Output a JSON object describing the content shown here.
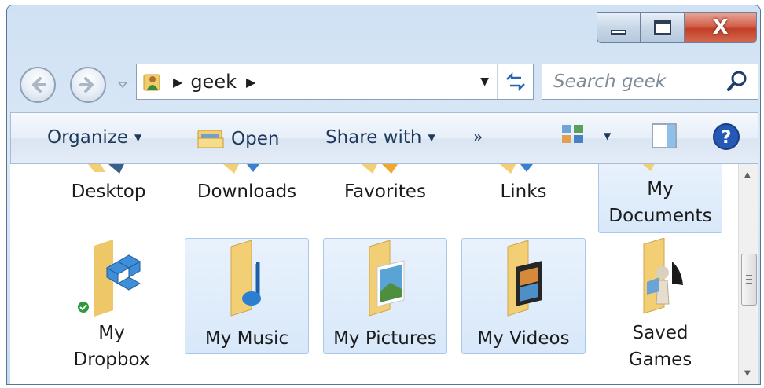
{
  "window": {
    "controls": {
      "minimize": "minimize",
      "maximize": "maximize",
      "close": "X"
    }
  },
  "navigation": {
    "breadcrumb": [
      "geek"
    ],
    "search_placeholder": "Search geek"
  },
  "toolbar": {
    "organize_label": "Organize",
    "open_label": "Open",
    "share_label": "Share with",
    "more_label": "»"
  },
  "items_top_row": [
    {
      "label": "Desktop",
      "selected": false
    },
    {
      "label": "Downloads",
      "selected": false
    },
    {
      "label": "Favorites",
      "selected": false
    },
    {
      "label": "Links",
      "selected": false
    },
    {
      "label": "My Documents",
      "selected": true
    }
  ],
  "items_second_row": [
    {
      "label_line1": "My",
      "label_line2": "Dropbox",
      "selected": false,
      "badge": "sync-ok"
    },
    {
      "label": "My Music",
      "selected": true
    },
    {
      "label": "My Pictures",
      "selected": true
    },
    {
      "label": "My Videos",
      "selected": true
    },
    {
      "label_line1": "Saved",
      "label_line2": "Games",
      "selected": false
    }
  ],
  "colors": {
    "selection_bg": "#d8e8fa",
    "selection_border": "#a9c8ea",
    "toolbar_text": "#1e395b",
    "close_button": "#c23f28",
    "folder_yellow": "#f2cf74"
  }
}
